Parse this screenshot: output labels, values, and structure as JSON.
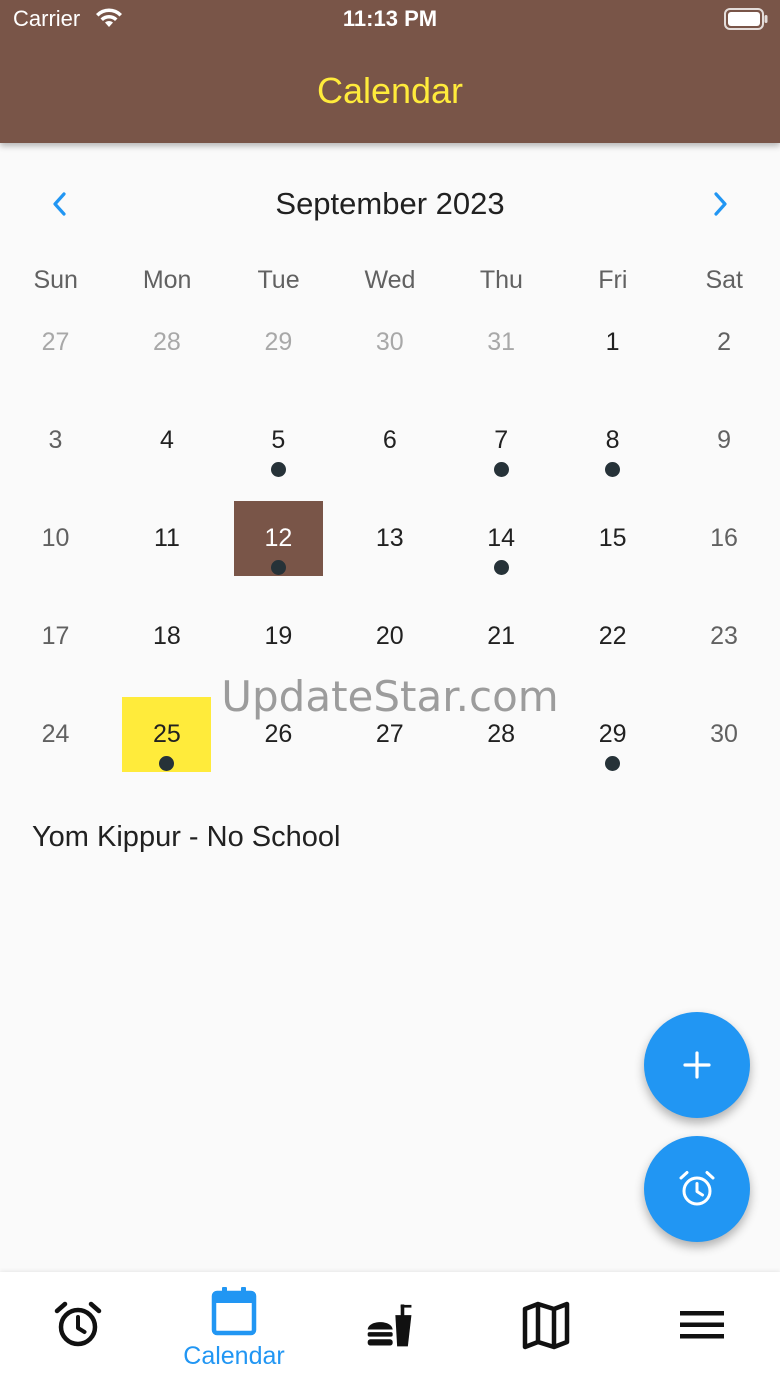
{
  "status_bar": {
    "carrier": "Carrier",
    "time": "11:13 PM"
  },
  "app_bar": {
    "title": "Calendar"
  },
  "calendar": {
    "month_title": "September 2023",
    "weekdays": [
      "Sun",
      "Mon",
      "Tue",
      "Wed",
      "Thu",
      "Fri",
      "Sat"
    ],
    "weeks": [
      [
        {
          "day": "27",
          "outside": true
        },
        {
          "day": "28",
          "outside": true
        },
        {
          "day": "29",
          "outside": true
        },
        {
          "day": "30",
          "outside": true
        },
        {
          "day": "31",
          "outside": true
        },
        {
          "day": "1"
        },
        {
          "day": "2"
        }
      ],
      [
        {
          "day": "3"
        },
        {
          "day": "4"
        },
        {
          "day": "5",
          "event": true
        },
        {
          "day": "6"
        },
        {
          "day": "7",
          "event": true
        },
        {
          "day": "8",
          "event": true
        },
        {
          "day": "9"
        }
      ],
      [
        {
          "day": "10"
        },
        {
          "day": "11"
        },
        {
          "day": "12",
          "event": true,
          "selected": true
        },
        {
          "day": "13"
        },
        {
          "day": "14",
          "event": true
        },
        {
          "day": "15"
        },
        {
          "day": "16"
        }
      ],
      [
        {
          "day": "17"
        },
        {
          "day": "18"
        },
        {
          "day": "19"
        },
        {
          "day": "20"
        },
        {
          "day": "21"
        },
        {
          "day": "22"
        },
        {
          "day": "23"
        }
      ],
      [
        {
          "day": "24"
        },
        {
          "day": "25",
          "event": true,
          "today": true
        },
        {
          "day": "26"
        },
        {
          "day": "27"
        },
        {
          "day": "28"
        },
        {
          "day": "29",
          "event": true
        },
        {
          "day": "30"
        }
      ]
    ],
    "colors": {
      "selected": "#795548",
      "today": "#ffeb3b",
      "event_dot": "#263238",
      "nav_arrow": "#2196f3"
    }
  },
  "watermark": "UpdateStar.com",
  "event": {
    "title": "Yom Kippur - No School"
  },
  "fabs": [
    {
      "name": "add-event",
      "icon": "plus-icon"
    },
    {
      "name": "reminder",
      "icon": "alarm-icon"
    }
  ],
  "bottom_nav": {
    "active": "Calendar",
    "items": [
      {
        "icon": "alarm-clock-icon",
        "label": ""
      },
      {
        "icon": "calendar-icon",
        "label": "Calendar"
      },
      {
        "icon": "fastfood-icon",
        "label": ""
      },
      {
        "icon": "map-icon",
        "label": ""
      },
      {
        "icon": "menu-icon",
        "label": ""
      }
    ]
  },
  "theme": {
    "primary": "#795548",
    "accent": "#ffeb3b",
    "blue": "#2196f3"
  }
}
